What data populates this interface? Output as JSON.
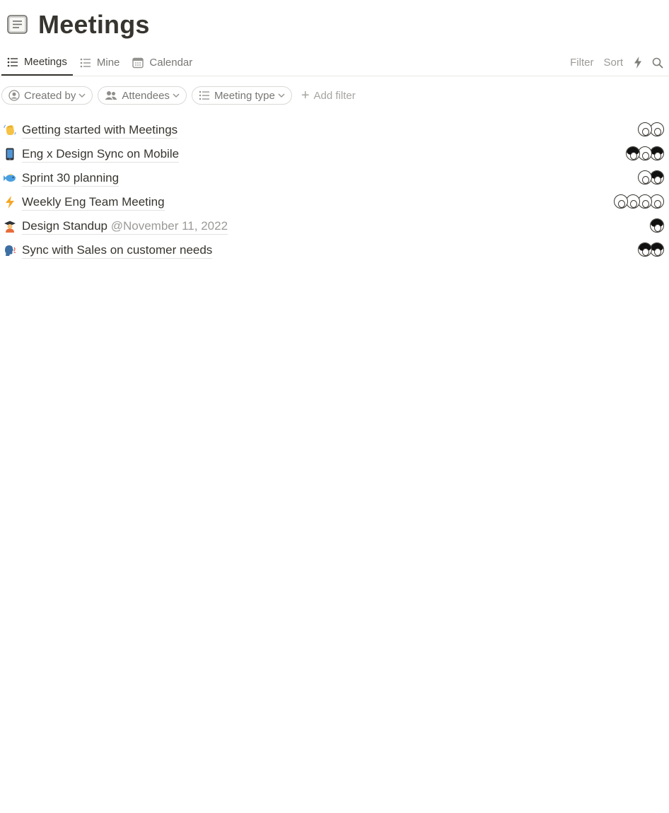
{
  "page": {
    "title": "Meetings",
    "icon": "document-icon"
  },
  "tabs": [
    {
      "label": "Meetings",
      "icon": "list-icon",
      "active": true
    },
    {
      "label": "Mine",
      "icon": "list-icon",
      "active": false
    },
    {
      "label": "Calendar",
      "icon": "calendar-icon",
      "active": false
    }
  ],
  "toolbar": {
    "filter_label": "Filter",
    "sort_label": "Sort",
    "automation_icon": "lightning-icon",
    "search_icon": "search-icon"
  },
  "filters": {
    "chips": [
      {
        "label": "Created by",
        "icon": "person-circle-icon"
      },
      {
        "label": "Attendees",
        "icon": "people-icon"
      },
      {
        "label": "Meeting type",
        "icon": "list-icon"
      }
    ],
    "add_label": "Add filter"
  },
  "meetings": [
    {
      "title": "Getting started with Meetings",
      "date": "",
      "icon": "waving-hand-icon",
      "attendees": 2
    },
    {
      "title": "Eng x Design Sync on Mobile",
      "date": "",
      "icon": "mobile-phone-icon",
      "attendees": 3
    },
    {
      "title": "Sprint 30 planning",
      "date": "",
      "icon": "fish-icon",
      "attendees": 2
    },
    {
      "title": "Weekly Eng Team Meeting",
      "date": "",
      "icon": "lightning-icon",
      "attendees": 4
    },
    {
      "title": "Design Standup",
      "date": "@November 11, 2022",
      "icon": "student-icon",
      "attendees": 1
    },
    {
      "title": "Sync with Sales on customer needs",
      "date": "",
      "icon": "speaking-head-icon",
      "attendees": 2
    }
  ],
  "colors": {
    "text": "#37352f",
    "muted": "#787774",
    "faint": "#9b9a97",
    "border": "#e9e9e7",
    "lightning": "#f5a623"
  }
}
